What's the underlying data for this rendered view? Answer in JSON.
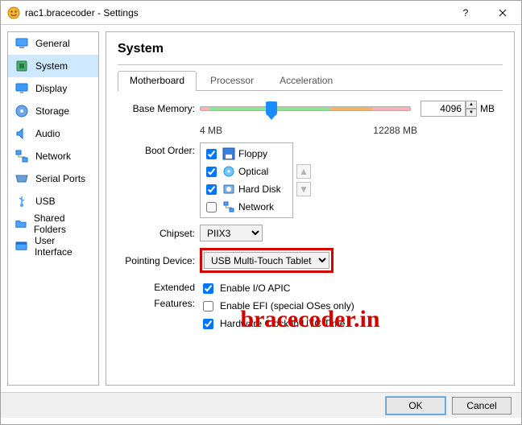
{
  "window": {
    "title": "rac1.bracecoder - Settings"
  },
  "sidebar": {
    "items": [
      {
        "label": "General"
      },
      {
        "label": "System"
      },
      {
        "label": "Display"
      },
      {
        "label": "Storage"
      },
      {
        "label": "Audio"
      },
      {
        "label": "Network"
      },
      {
        "label": "Serial Ports"
      },
      {
        "label": "USB"
      },
      {
        "label": "Shared Folders"
      },
      {
        "label": "User Interface"
      }
    ],
    "selected_index": 1
  },
  "page": {
    "heading": "System",
    "tabs": [
      {
        "label": "Motherboard"
      },
      {
        "label": "Processor"
      },
      {
        "label": "Acceleration"
      }
    ],
    "active_tab": 0,
    "base_memory": {
      "label": "Base Memory:",
      "min_label": "4 MB",
      "max_label": "12288 MB",
      "value": "4096",
      "unit": "MB",
      "thumb_pct": 34
    },
    "boot_order": {
      "label": "Boot Order:",
      "items": [
        {
          "label": "Floppy",
          "checked": true,
          "icon": "floppy-icon"
        },
        {
          "label": "Optical",
          "checked": true,
          "icon": "optical-icon"
        },
        {
          "label": "Hard Disk",
          "checked": true,
          "icon": "harddisk-icon"
        },
        {
          "label": "Network",
          "checked": false,
          "icon": "network-boot-icon"
        }
      ]
    },
    "chipset": {
      "label": "Chipset:",
      "value": "PIIX3"
    },
    "pointing_device": {
      "label": "Pointing Device:",
      "value": "USB Multi-Touch Tablet"
    },
    "extended_features": {
      "label": "Extended Features:",
      "items": [
        {
          "label": "Enable I/O APIC",
          "checked": true
        },
        {
          "label": "Enable EFI (special OSes only)",
          "checked": false
        },
        {
          "label": "Hardware Clock in UTC Time",
          "checked": true
        }
      ]
    },
    "watermark": "bracecoder.in"
  },
  "footer": {
    "ok": "OK",
    "cancel": "Cancel"
  }
}
